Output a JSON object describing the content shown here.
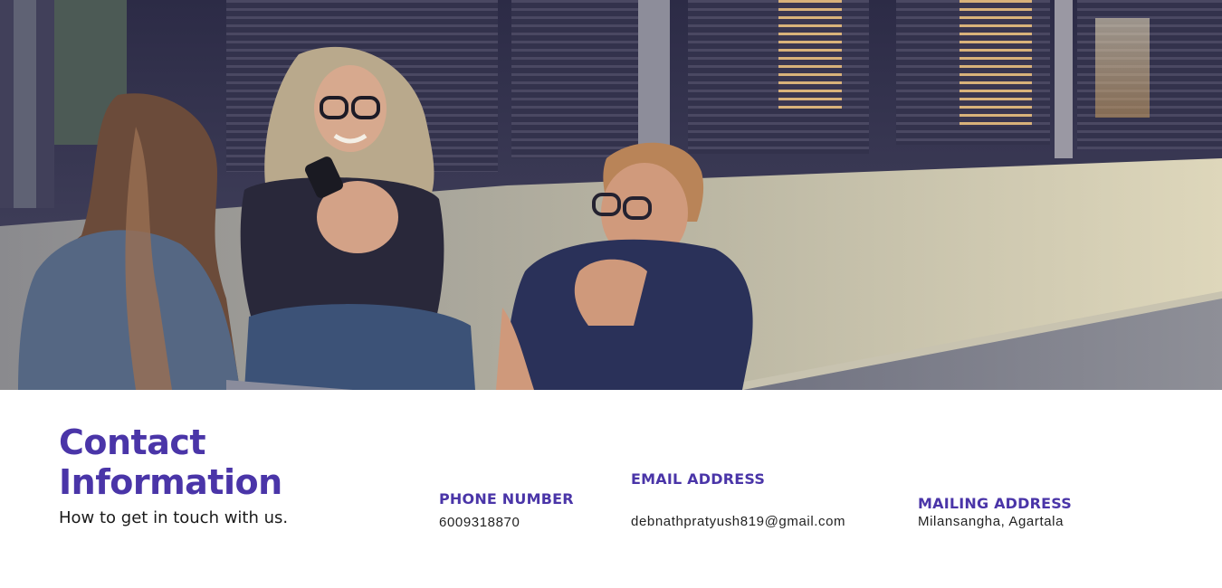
{
  "hero": {
    "image_icon": "photo-of-three-people-sitting-outdoors"
  },
  "contact": {
    "title": "Contact Information",
    "subtitle": "How to get in touch with us.",
    "phone": {
      "label": "PHONE NUMBER",
      "value": "6009318870"
    },
    "email": {
      "label": "EMAIL ADDRESS",
      "value": "debnathpratyush819@gmail.com"
    },
    "mailing": {
      "label": "MAILING ADDRESS",
      "value": "Milansangha, Agartala"
    }
  },
  "colors": {
    "accent": "#4a35a8",
    "text": "#1a1a1a",
    "background": "#ffffff"
  }
}
